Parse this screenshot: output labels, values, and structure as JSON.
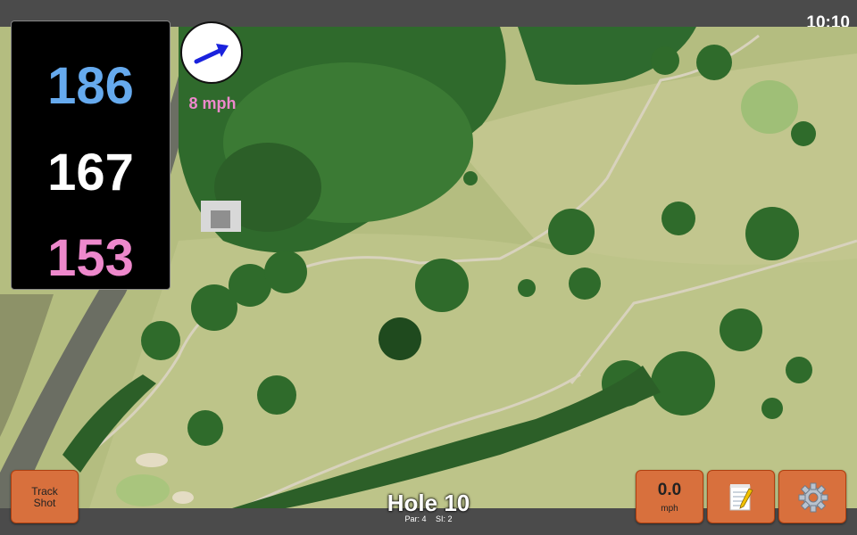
{
  "status": {
    "time": "10:10"
  },
  "yardages": {
    "back": "186",
    "middle": "167",
    "front": "153",
    "colors": {
      "back": "#66aaee",
      "middle": "#ffffff",
      "front": "#ee88cc"
    }
  },
  "wind": {
    "speed_label": "8 mph",
    "icon": "wind-arrow-icon",
    "arrow_color": "#1a22dd",
    "label_color": "#ee88cc"
  },
  "buttons": {
    "track_shot": {
      "line1": "Track",
      "line2": "Shot"
    },
    "speed": {
      "value": "0.0",
      "unit": "mph"
    },
    "notes": {
      "icon": "notepad-icon"
    },
    "settings": {
      "icon": "gear-icon"
    },
    "accent": "#d8703d"
  },
  "hole": {
    "title": "Hole 10",
    "par_label": "Par: 4",
    "si_label": "SI: 2"
  }
}
